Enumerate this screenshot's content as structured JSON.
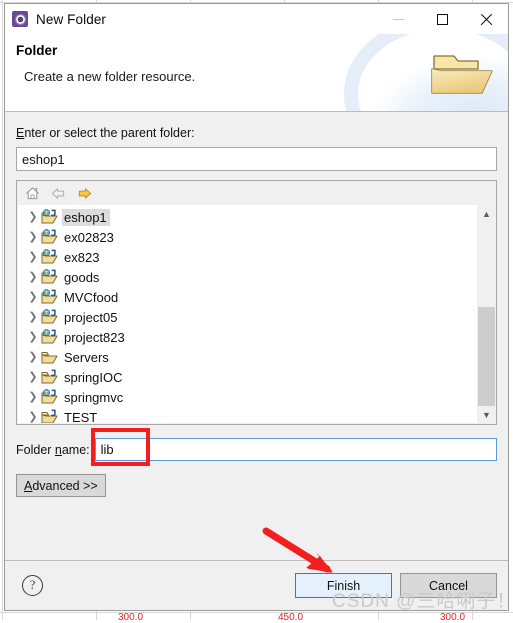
{
  "window": {
    "title": "New Folder",
    "app_icon": "eclipse-icon",
    "controls": {
      "minimize": "minimize-icon",
      "maximize": "maximize-icon",
      "close": "close-icon"
    }
  },
  "banner": {
    "title": "Folder",
    "description": "Create a new folder resource.",
    "graphic": "open-folder-icon"
  },
  "form": {
    "parent_label": "Enter or select the parent folder:",
    "parent_label_mnemonic": "E",
    "parent_value": "eshop1",
    "parent_placeholder": "",
    "folder_name_label": "Folder name:",
    "folder_name_mnemonic": "n",
    "folder_name_value": "lib",
    "folder_name_placeholder": "",
    "advanced_label": "Advanced >>"
  },
  "tree": {
    "toolbar": [
      {
        "name": "home-icon",
        "label": "Home",
        "enabled": true
      },
      {
        "name": "back-arrow-icon",
        "label": "Back",
        "enabled": false
      },
      {
        "name": "forward-arrow-icon",
        "label": "Forward",
        "enabled": true
      }
    ],
    "items": [
      {
        "label": "eshop1",
        "icon": "web-project-folder-icon",
        "selected": true,
        "expandable": true
      },
      {
        "label": "ex02823",
        "icon": "web-project-folder-icon",
        "selected": false,
        "expandable": true
      },
      {
        "label": "ex823",
        "icon": "web-project-folder-icon",
        "selected": false,
        "expandable": true
      },
      {
        "label": "goods",
        "icon": "web-project-folder-icon",
        "selected": false,
        "expandable": true
      },
      {
        "label": "MVCfood",
        "icon": "web-project-folder-icon",
        "selected": false,
        "expandable": true
      },
      {
        "label": "project05",
        "icon": "web-project-folder-icon",
        "selected": false,
        "expandable": true
      },
      {
        "label": "project823",
        "icon": "web-project-folder-icon",
        "selected": false,
        "expandable": true
      },
      {
        "label": "Servers",
        "icon": "plain-folder-icon",
        "selected": false,
        "expandable": true
      },
      {
        "label": "springIOC",
        "icon": "java-project-folder-icon",
        "selected": false,
        "expandable": true
      },
      {
        "label": "springmvc",
        "icon": "web-project-folder-icon",
        "selected": false,
        "expandable": true
      },
      {
        "label": "TEST",
        "icon": "java-project-folder-icon",
        "selected": false,
        "expandable": true
      }
    ],
    "scroll": {
      "thumb_top_pct": 46,
      "thumb_height_pct": 54
    }
  },
  "footer": {
    "help_glyph": "?",
    "finish_label": "Finish",
    "cancel_label": "Cancel"
  },
  "annotations": {
    "highlight_color": "#f31f1f",
    "rect_target": "folder-name-input",
    "arrow_target": "finish-button",
    "watermark": "CSDN @三哈唎子！"
  },
  "background": {
    "numbers": [
      "300.0",
      "450.0",
      "300.0"
    ]
  }
}
